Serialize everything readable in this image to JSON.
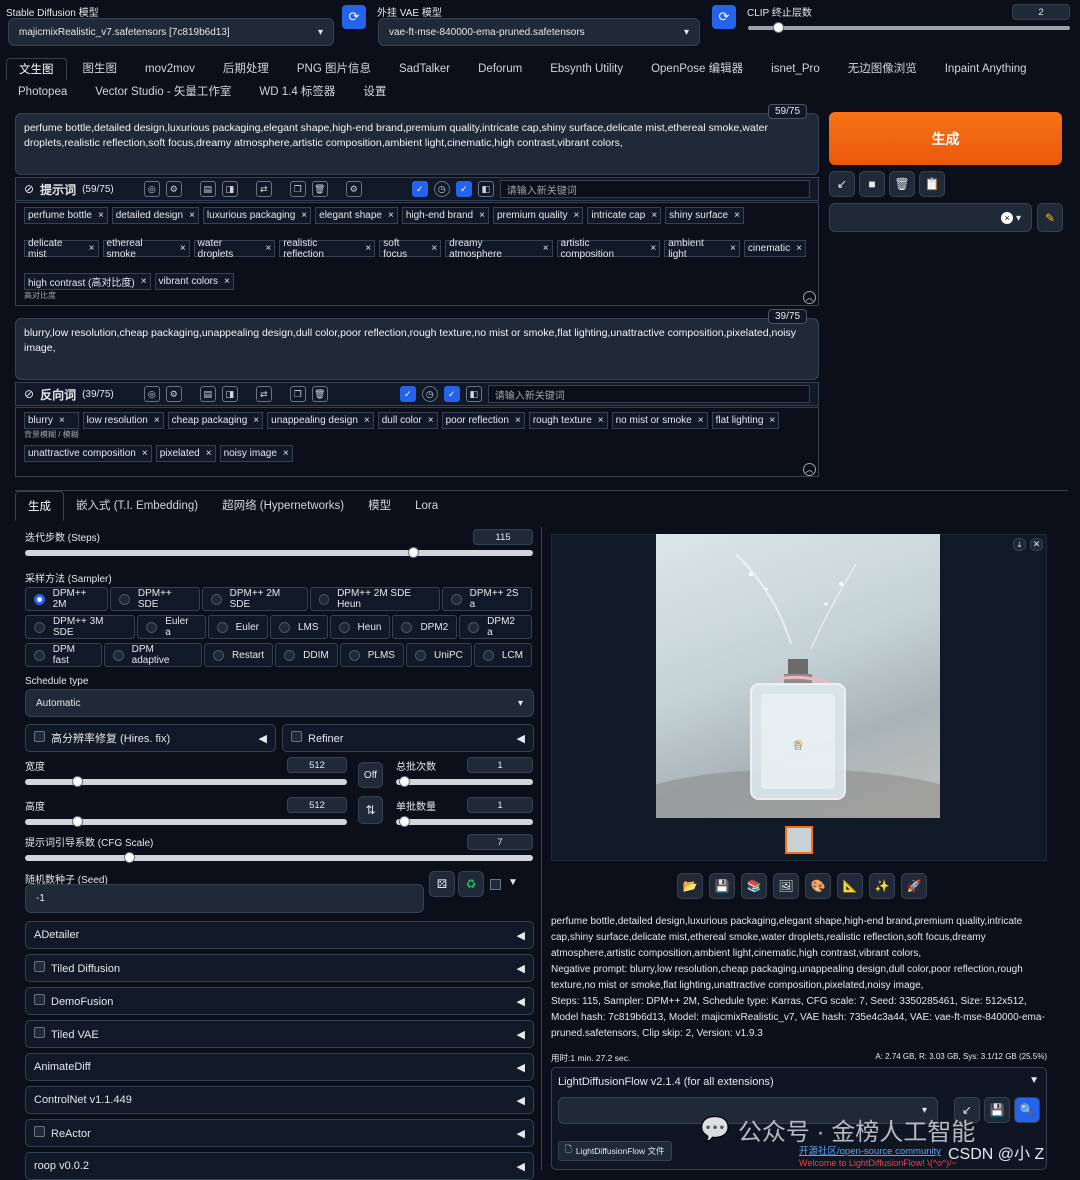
{
  "top": {
    "sd_label": "Stable Diffusion 模型",
    "sd_value": "majicmixRealistic_v7.safetensors [7c819b6d13]",
    "vae_label": "外挂 VAE 模型",
    "vae_value": "vae-ft-mse-840000-ema-pruned.safetensors",
    "clip_label": "CLIP 终止层数",
    "clip_value": "2",
    "clip_fraction": 0.08
  },
  "tabs": [
    "文生图",
    "图生图",
    "mov2mov",
    "后期处理",
    "PNG 图片信息",
    "SadTalker",
    "Deforum",
    "Ebsynth Utility",
    "OpenPose 编辑器",
    "isnet_Pro",
    "无边图像浏览",
    "Inpaint Anything",
    "Photopea",
    "Vector Studio - 矢量工作室",
    "WD 1.4 标签器",
    "设置"
  ],
  "positive": {
    "text": "perfume bottle,detailed design,luxurious packaging,elegant shape,high-end brand,premium quality,intricate cap,shiny surface,delicate mist,ethereal smoke,water droplets,realistic reflection,soft focus,dreamy atmosphere,artistic composition,ambient light,cinematic,high contrast,vibrant colors,",
    "counter": "59/75",
    "label": "提示词",
    "count": "(59/75)",
    "keyword_placeholder": "请输入新关键词",
    "tags": [
      [
        "perfume bottle",
        "detailed design",
        "luxurious packaging",
        "elegant shape",
        "high-end brand",
        "premium quality",
        "intricate cap",
        "shiny surface"
      ],
      [
        "delicate mist",
        "ethereal smoke",
        "water droplets",
        "realistic reflection",
        "soft focus",
        "dreamy atmosphere",
        "artistic composition",
        "ambient light",
        "cinematic"
      ],
      [
        "high contrast (高对比度)",
        "vibrant colors"
      ]
    ],
    "subs": [
      [
        "",
        "",
        "",
        "",
        "",
        "",
        "",
        ""
      ],
      [
        "",
        "",
        "",
        "",
        "",
        "",
        "",
        "",
        ""
      ],
      [
        "高对比度",
        ""
      ]
    ]
  },
  "negative": {
    "text": "blurry,low resolution,cheap packaging,unappealing design,dull color,poor reflection,rough texture,no mist or smoke,flat lighting,unattractive composition,pixelated,noisy image,",
    "counter": "39/75",
    "label": "反向词",
    "count": "(39/75)",
    "keyword_placeholder": "请输入新关键词",
    "tags": [
      [
        "blurry",
        "low resolution",
        "cheap packaging",
        "unappealing design",
        "dull color",
        "poor reflection",
        "rough texture",
        "no mist or smoke",
        "flat lighting"
      ],
      [
        "unattractive composition",
        "pixelated",
        "noisy image"
      ]
    ],
    "subs": [
      [
        "背景模糊 / 模糊",
        "",
        "",
        "",
        "",
        "",
        "",
        "",
        ""
      ],
      [
        "",
        "",
        ""
      ]
    ]
  },
  "generate": "生成",
  "subtabs": [
    "生成",
    "嵌入式 (T.I. Embedding)",
    "超网络 (Hypernetworks)",
    "模型",
    "Lora"
  ],
  "steps": {
    "label": "迭代步数 (Steps)",
    "value": "115",
    "fraction": 0.77
  },
  "sampler": {
    "label": "采样方法 (Sampler)",
    "rows": [
      [
        "DPM++ 2M",
        "DPM++ SDE",
        "DPM++ 2M SDE",
        "DPM++ 2M SDE Heun",
        "DPM++ 2S a"
      ],
      [
        "DPM++ 3M SDE",
        "Euler a",
        "Euler",
        "LMS",
        "Heun",
        "DPM2",
        "DPM2 a"
      ],
      [
        "DPM fast",
        "DPM adaptive",
        "Restart",
        "DDIM",
        "PLMS",
        "UniPC",
        "LCM"
      ]
    ],
    "selected": "DPM++ 2M"
  },
  "schedule": {
    "label": "Schedule type",
    "value": "Automatic"
  },
  "hires": "高分辨率修复 (Hires. fix)",
  "refiner": "Refiner",
  "width": {
    "label": "宽度",
    "value": "512",
    "fraction": 0.15
  },
  "height": {
    "label": "高度",
    "value": "512",
    "fraction": 0.15
  },
  "batch_count": {
    "label": "总批次数",
    "value": "1",
    "fraction": 0.02
  },
  "batch_size": {
    "label": "单批数量",
    "value": "1",
    "fraction": 0.02
  },
  "off": "Off",
  "cfg": {
    "label": "提示词引导系数 (CFG Scale)",
    "value": "7",
    "fraction": 0.2
  },
  "seed": {
    "label": "随机数种子 (Seed)",
    "value": "-1"
  },
  "accordions": [
    {
      "label": "ADetailer",
      "cb": false
    },
    {
      "label": "Tiled Diffusion",
      "cb": true
    },
    {
      "label": "DemoFusion",
      "cb": true
    },
    {
      "label": "Tiled VAE",
      "cb": true
    },
    {
      "label": "AnimateDiff",
      "cb": false
    },
    {
      "label": "ControlNet v1.1.449",
      "cb": false
    },
    {
      "label": "ReActor",
      "cb": true
    },
    {
      "label": "roop v0.0.2",
      "cb": false
    }
  ],
  "info": {
    "prompt": "perfume bottle,detailed design,luxurious packaging,elegant shape,high-end brand,premium quality,intricate cap,shiny surface,delicate mist,ethereal smoke,water droplets,realistic reflection,soft focus,dreamy atmosphere,artistic composition,ambient light,cinematic,high contrast,vibrant colors,",
    "negative": "Negative prompt: blurry,low resolution,cheap packaging,unappealing design,dull color,poor reflection,rough texture,no mist or smoke,flat lighting,unattractive composition,pixelated,noisy image,",
    "params": "Steps: 115, Sampler: DPM++ 2M, Schedule type: Karras, CFG scale: 7, Seed: 3350285461, Size: 512x512, Model hash: 7c819b6d13, Model: majicmixRealistic_v7, VAE hash: 735e4c3a44, VAE: vae-ft-mse-840000-ema-pruned.safetensors, Clip skip: 2, Version: v1.9.3",
    "time": "用时:1 min. 27.2 sec.",
    "mem": "A: 2.74 GB, R: 3.03 GB, Sys: 3.1/12 GB (25.5%)"
  },
  "ldf": {
    "title": "LightDiffusionFlow v2.1.4 (for all extensions)",
    "file": "LightDiffusionFlow 文件",
    "link": "开源社区/open-source community",
    "welcome": "Welcome to LightDiffusionFlow! \\(^o^)/~"
  },
  "watermark": {
    "wx": "公众号 · 金榜人工智能",
    "csdn": "CSDN @小 Z"
  }
}
